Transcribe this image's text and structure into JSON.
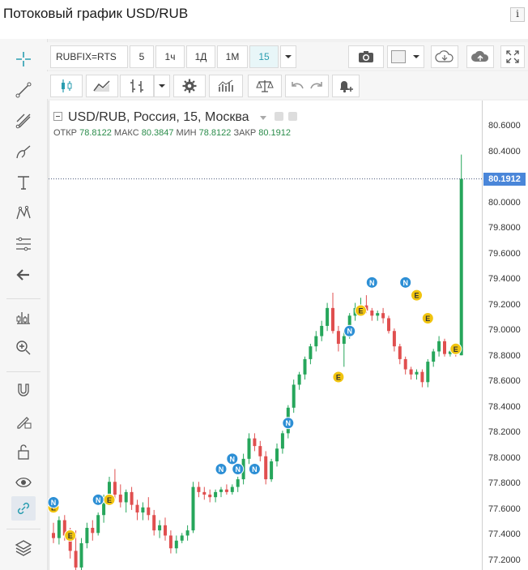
{
  "page_title": "Потоковый график USD/RUB",
  "info_icon": "i",
  "toolbar": {
    "symbol": "RUBFIX=RTS",
    "timeframes": [
      "5",
      "1ч",
      "1Д",
      "1М",
      "15"
    ],
    "active_timeframe": "15"
  },
  "legend": {
    "title": "USD/RUB, Россия, 15, Москва",
    "open_label": "ОТКР",
    "open": "78.8122",
    "high_label": "МАКС",
    "high": "80.3847",
    "low_label": "МИН",
    "low": "78.8122",
    "close_label": "ЗАКР",
    "close": "80.1912"
  },
  "last_price": "80.1912",
  "chart_data": {
    "type": "candlestick",
    "symbol": "USD/RUB",
    "yticks": [
      "80.6000",
      "80.4000",
      "80.2000",
      "80.0000",
      "79.8000",
      "79.6000",
      "79.4000",
      "79.2000",
      "79.0000",
      "78.8000",
      "78.6000",
      "78.4000",
      "78.2000",
      "78.0000",
      "77.8000",
      "77.6000",
      "77.4000",
      "77.2000"
    ],
    "ylim": [
      77.15,
      80.75
    ],
    "up_color": "#26a65b",
    "down_color": "#e04f4f",
    "candles": [
      [
        77.42,
        77.5,
        77.34,
        77.38
      ],
      [
        77.38,
        77.55,
        77.33,
        77.52
      ],
      [
        77.52,
        77.56,
        77.36,
        77.4
      ],
      [
        77.4,
        77.46,
        77.22,
        77.28
      ],
      [
        77.28,
        77.44,
        77.1,
        77.15
      ],
      [
        77.15,
        77.38,
        77.1,
        77.34
      ],
      [
        77.34,
        77.5,
        77.3,
        77.46
      ],
      [
        77.46,
        77.52,
        77.36,
        77.42
      ],
      [
        77.42,
        77.58,
        77.4,
        77.56
      ],
      [
        77.56,
        77.72,
        77.5,
        77.7
      ],
      [
        77.7,
        77.86,
        77.66,
        77.82
      ],
      [
        77.82,
        77.92,
        77.68,
        77.72
      ],
      [
        77.72,
        77.8,
        77.62,
        77.66
      ],
      [
        77.66,
        77.76,
        77.58,
        77.74
      ],
      [
        77.74,
        77.78,
        77.6,
        77.64
      ],
      [
        77.64,
        77.68,
        77.52,
        77.58
      ],
      [
        77.58,
        77.66,
        77.52,
        77.62
      ],
      [
        77.62,
        77.7,
        77.52,
        77.56
      ],
      [
        77.56,
        77.6,
        77.4,
        77.44
      ],
      [
        77.44,
        77.52,
        77.38,
        77.48
      ],
      [
        77.48,
        77.54,
        77.36,
        77.4
      ],
      [
        77.4,
        77.44,
        77.26,
        77.3
      ],
      [
        77.3,
        77.4,
        77.26,
        77.36
      ],
      [
        77.36,
        77.42,
        77.34,
        77.4
      ],
      [
        77.4,
        77.48,
        77.36,
        77.44
      ],
      [
        77.44,
        77.82,
        77.42,
        77.78
      ],
      [
        77.78,
        77.82,
        77.7,
        77.74
      ],
      [
        77.74,
        77.78,
        77.68,
        77.72
      ],
      [
        77.72,
        77.76,
        77.66,
        77.7
      ],
      [
        77.7,
        77.76,
        77.66,
        77.74
      ],
      [
        77.74,
        77.78,
        77.7,
        77.76
      ],
      [
        77.76,
        77.8,
        77.72,
        77.74
      ],
      [
        77.74,
        77.8,
        77.72,
        77.78
      ],
      [
        77.78,
        77.86,
        77.74,
        77.84
      ],
      [
        77.84,
        78.04,
        77.8,
        78.0
      ],
      [
        78.0,
        78.2,
        77.96,
        78.16
      ],
      [
        78.16,
        78.2,
        78.06,
        78.1
      ],
      [
        78.1,
        78.14,
        77.98,
        78.02
      ],
      [
        78.02,
        78.06,
        77.8,
        77.84
      ],
      [
        77.84,
        78.0,
        77.82,
        77.98
      ],
      [
        77.98,
        78.12,
        77.94,
        78.08
      ],
      [
        78.08,
        78.22,
        78.04,
        78.2
      ],
      [
        78.2,
        78.42,
        78.16,
        78.4
      ],
      [
        78.4,
        78.62,
        78.36,
        78.58
      ],
      [
        78.58,
        78.68,
        78.54,
        78.66
      ],
      [
        78.66,
        78.8,
        78.62,
        78.78
      ],
      [
        78.78,
        78.9,
        78.74,
        78.88
      ],
      [
        78.88,
        79.0,
        78.84,
        78.96
      ],
      [
        78.96,
        79.08,
        78.92,
        79.04
      ],
      [
        79.04,
        79.22,
        79.0,
        79.18
      ],
      [
        79.18,
        79.3,
        78.98,
        79.0
      ],
      [
        79.0,
        79.04,
        78.84,
        78.9
      ],
      [
        78.9,
        79.0,
        78.72,
        78.96
      ],
      [
        78.96,
        79.14,
        78.94,
        79.12
      ],
      [
        79.12,
        79.22,
        79.08,
        79.18
      ],
      [
        79.18,
        79.26,
        79.12,
        79.2
      ],
      [
        79.2,
        79.28,
        79.14,
        79.16
      ],
      [
        79.16,
        79.18,
        79.08,
        79.12
      ],
      [
        79.12,
        79.16,
        79.08,
        79.14
      ],
      [
        79.14,
        79.18,
        79.06,
        79.1
      ],
      [
        79.1,
        79.12,
        78.98,
        79.0
      ],
      [
        79.0,
        79.02,
        78.84,
        78.88
      ],
      [
        78.88,
        78.9,
        78.74,
        78.78
      ],
      [
        78.78,
        78.8,
        78.66,
        78.7
      ],
      [
        78.7,
        78.72,
        78.62,
        78.66
      ],
      [
        78.66,
        78.7,
        78.62,
        78.68
      ],
      [
        78.68,
        78.7,
        78.56,
        78.6
      ],
      [
        78.6,
        78.78,
        78.56,
        78.76
      ],
      [
        78.76,
        78.86,
        78.72,
        78.84
      ],
      [
        78.84,
        78.96,
        78.8,
        78.92
      ],
      [
        78.92,
        78.94,
        78.8,
        78.82
      ],
      [
        78.82,
        78.86,
        78.8,
        78.84
      ],
      [
        78.84,
        78.86,
        78.8,
        78.82
      ],
      [
        78.81,
        80.38,
        78.81,
        80.19
      ]
    ],
    "markers": [
      {
        "type": "E",
        "candle": 0,
        "price": 77.62
      },
      {
        "type": "N",
        "candle": 0,
        "price": 77.66
      },
      {
        "type": "E",
        "candle": 3,
        "price": 77.4
      },
      {
        "type": "N",
        "candle": 8,
        "price": 77.68
      },
      {
        "type": "E",
        "candle": 10,
        "price": 77.68
      },
      {
        "type": "N",
        "candle": 30,
        "price": 77.92
      },
      {
        "type": "N",
        "candle": 32,
        "price": 78.0
      },
      {
        "type": "N",
        "candle": 33,
        "price": 77.92
      },
      {
        "type": "N",
        "candle": 36,
        "price": 77.92
      },
      {
        "type": "N",
        "candle": 42,
        "price": 78.28
      },
      {
        "type": "E",
        "candle": 51,
        "price": 78.64
      },
      {
        "type": "N",
        "candle": 53,
        "price": 79.0
      },
      {
        "type": "E",
        "candle": 55,
        "price": 79.16
      },
      {
        "type": "N",
        "candle": 57,
        "price": 79.38
      },
      {
        "type": "N",
        "candle": 63,
        "price": 79.38
      },
      {
        "type": "E",
        "candle": 65,
        "price": 79.28
      },
      {
        "type": "E",
        "candle": 67,
        "price": 79.1
      },
      {
        "type": "E",
        "candle": 72,
        "price": 78.86
      }
    ]
  },
  "icons": {
    "camera": "camera-icon",
    "cloud_download": "cloud-download-icon",
    "cloud_upload": "cloud-upload-icon",
    "fullscreen": "fullscreen-icon"
  }
}
